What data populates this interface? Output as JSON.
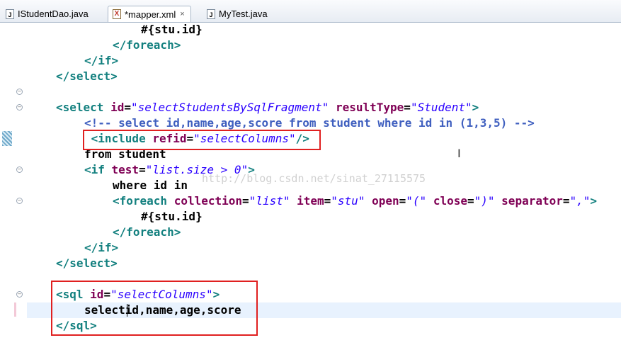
{
  "tabs": [
    {
      "label": "IStudentDao.java",
      "icon": "java-file-icon",
      "active": false
    },
    {
      "label": "*mapper.xml",
      "icon": "xml-file-icon",
      "active": true
    },
    {
      "label": "MyTest.java",
      "icon": "java-file-icon",
      "active": false
    }
  ],
  "close_glyph": "×",
  "editor": {
    "lines": [
      {
        "indent": 6,
        "tokens": [
          {
            "t": "#{stu.id}",
            "c": "text"
          }
        ]
      },
      {
        "indent": 4,
        "tokens": [
          {
            "t": "</foreach>",
            "c": "tag"
          }
        ]
      },
      {
        "indent": 2,
        "tokens": [
          {
            "t": "</if>",
            "c": "tag"
          }
        ]
      },
      {
        "indent": 0,
        "tokens": [
          {
            "t": "</select>",
            "c": "tag"
          }
        ]
      },
      {
        "indent": 0,
        "tokens": []
      },
      {
        "indent": 0,
        "tokens": [
          {
            "t": "<select ",
            "c": "tag"
          },
          {
            "t": "id",
            "c": "attr"
          },
          {
            "t": "=",
            "c": "text"
          },
          {
            "t": "\"selectStudentsBySqlFragment\"",
            "c": "val"
          },
          {
            "t": " ",
            "c": "text"
          },
          {
            "t": "resultType",
            "c": "attr"
          },
          {
            "t": "=",
            "c": "text"
          },
          {
            "t": "\"Student\"",
            "c": "val"
          },
          {
            "t": ">",
            "c": "tag"
          }
        ]
      },
      {
        "indent": 2,
        "tokens": [
          {
            "t": "<!-- select id,name,age,score from student where id in (1,3,5) -->",
            "c": "cmt"
          }
        ]
      },
      {
        "indent": 2,
        "tokens": [
          {
            "t": " <include ",
            "c": "tag"
          },
          {
            "t": "refid",
            "c": "attr"
          },
          {
            "t": "=",
            "c": "text"
          },
          {
            "t": "\"selectColumns\"",
            "c": "val"
          },
          {
            "t": "/>",
            "c": "tag"
          }
        ]
      },
      {
        "indent": 2,
        "tokens": [
          {
            "t": "from student",
            "c": "text"
          }
        ]
      },
      {
        "indent": 2,
        "tokens": [
          {
            "t": "<if ",
            "c": "tag"
          },
          {
            "t": "test",
            "c": "attr"
          },
          {
            "t": "=",
            "c": "text"
          },
          {
            "t": "\"list.size > 0\"",
            "c": "val"
          },
          {
            "t": ">",
            "c": "tag"
          }
        ]
      },
      {
        "indent": 4,
        "tokens": [
          {
            "t": "where id in",
            "c": "text"
          }
        ]
      },
      {
        "indent": 4,
        "tokens": [
          {
            "t": "<foreach ",
            "c": "tag"
          },
          {
            "t": "collection",
            "c": "attr"
          },
          {
            "t": "=",
            "c": "text"
          },
          {
            "t": "\"list\"",
            "c": "val"
          },
          {
            "t": " ",
            "c": "text"
          },
          {
            "t": "item",
            "c": "attr"
          },
          {
            "t": "=",
            "c": "text"
          },
          {
            "t": "\"stu\"",
            "c": "val"
          },
          {
            "t": " ",
            "c": "text"
          },
          {
            "t": "open",
            "c": "attr"
          },
          {
            "t": "=",
            "c": "text"
          },
          {
            "t": "\"(\"",
            "c": "val"
          },
          {
            "t": " ",
            "c": "text"
          },
          {
            "t": "close",
            "c": "attr"
          },
          {
            "t": "=",
            "c": "text"
          },
          {
            "t": "\")\"",
            "c": "val"
          },
          {
            "t": " ",
            "c": "text"
          },
          {
            "t": "separator",
            "c": "attr"
          },
          {
            "t": "=",
            "c": "text"
          },
          {
            "t": "\",\"",
            "c": "val"
          },
          {
            "t": ">",
            "c": "tag"
          }
        ]
      },
      {
        "indent": 6,
        "tokens": [
          {
            "t": "#{stu.id}",
            "c": "text"
          }
        ]
      },
      {
        "indent": 4,
        "tokens": [
          {
            "t": "</foreach>",
            "c": "tag"
          }
        ]
      },
      {
        "indent": 2,
        "tokens": [
          {
            "t": "</if>",
            "c": "tag"
          }
        ]
      },
      {
        "indent": 0,
        "tokens": [
          {
            "t": "</select>",
            "c": "tag"
          }
        ]
      },
      {
        "indent": 0,
        "tokens": []
      },
      {
        "indent": 0,
        "tokens": [
          {
            "t": "<sql ",
            "c": "tag"
          },
          {
            "t": "id",
            "c": "attr"
          },
          {
            "t": "=",
            "c": "text"
          },
          {
            "t": "\"selectColumns\"",
            "c": "val"
          },
          {
            "t": ">",
            "c": "tag"
          }
        ]
      },
      {
        "indent": 2,
        "tokens": [
          {
            "t": "selectid,name,age,score",
            "c": "text"
          }
        ]
      },
      {
        "indent": 0,
        "tokens": [
          {
            "t": "</sql>",
            "c": "tag"
          }
        ]
      }
    ]
  },
  "watermark": "http://blog.csdn.net/sinat_27115575",
  "colors": {
    "tag": "#13807f",
    "attr": "#7f0055",
    "value": "#2a00ff",
    "comment": "#3f5fbf",
    "highlight_box": "#e02020",
    "current_line": "#e8f2fe"
  }
}
